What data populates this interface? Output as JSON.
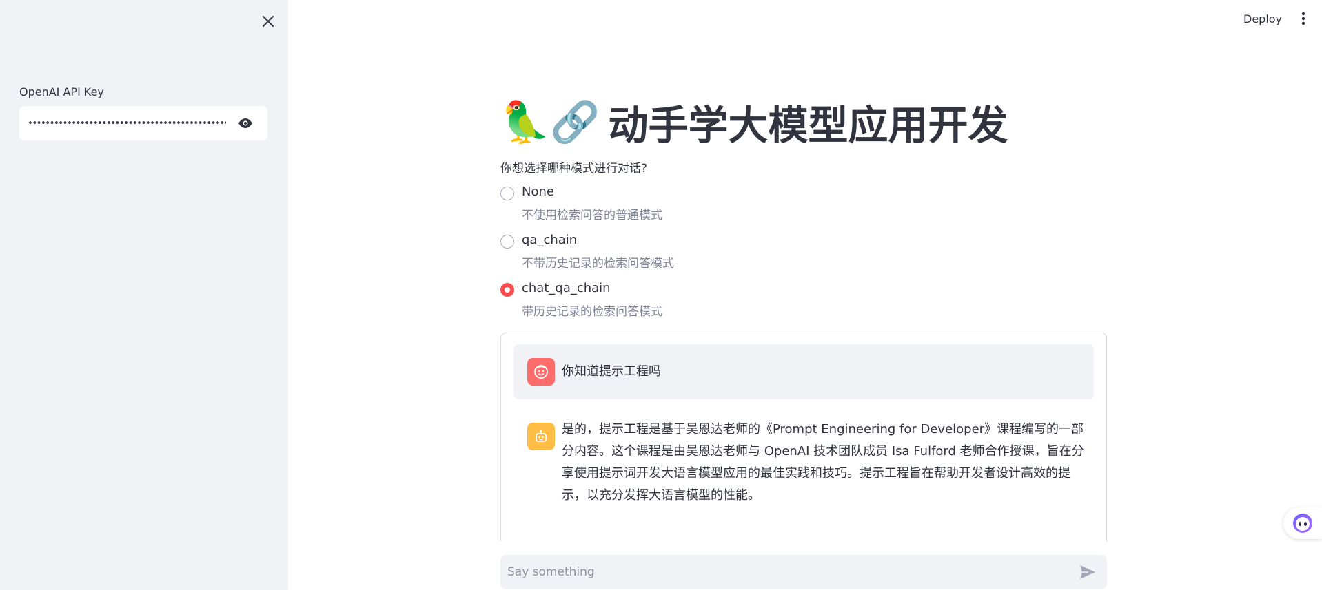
{
  "sidebar": {
    "api_key_label": "OpenAI API Key",
    "api_key_value": "••••••••••••••••••••••••••••••••••••••••••••••••••"
  },
  "header": {
    "deploy_label": "Deploy"
  },
  "main": {
    "title_emoji": "🦜🔗",
    "title_text": "动手学大模型应用开发",
    "question": "你想选择哪种模式进行对话?",
    "radio_options": [
      {
        "label": "None",
        "caption": "不使用检索问答的普通模式",
        "selected": false
      },
      {
        "label": "qa_chain",
        "caption": "不带历史记录的检索问答模式",
        "selected": false
      },
      {
        "label": "chat_qa_chain",
        "caption": "带历史记录的检索问答模式",
        "selected": true
      }
    ],
    "messages": [
      {
        "role": "user",
        "text": "你知道提示工程吗"
      },
      {
        "role": "assistant",
        "text": "是的，提示工程是基于吴恩达老师的《Prompt Engineering for Developer》课程编写的一部分内容。这个课程是由吴恩达老师与 OpenAI 技术团队成员 Isa Fulford 老师合作授课，旨在分享使用提示词开发大语言模型应用的最佳实践和技巧。提示工程旨在帮助开发者设计高效的提示，以充分发挥大语言模型的性能。"
      }
    ],
    "chat_input_placeholder": "Say something"
  },
  "colors": {
    "accent": "#ff4b4b",
    "sidebar_bg": "#f0f2f6",
    "user_avatar": "#ff6c6c",
    "bot_avatar": "#ffbd45"
  },
  "icons": {
    "sidebar_close": "close-icon",
    "password_toggle": "eye-icon",
    "menu": "kebab-menu-icon",
    "user_avatar": "user-face-icon",
    "bot_avatar": "robot-icon",
    "send": "send-icon",
    "floating": "assistant-icon"
  }
}
